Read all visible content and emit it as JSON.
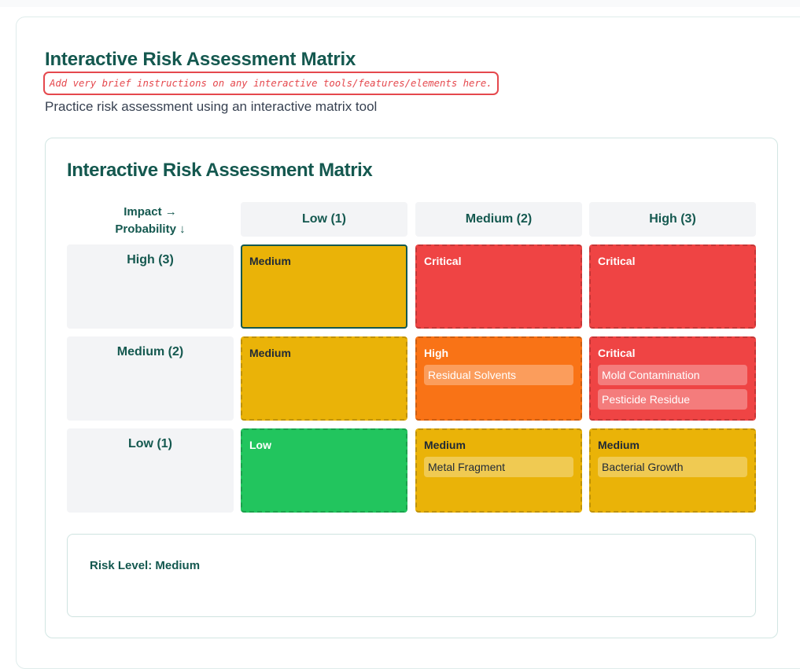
{
  "page": {
    "title": "Interactive Risk Assessment Matrix",
    "instruction": "Add very brief instructions on any interactive tools/features/elements here.",
    "subtitle": "Practice risk assessment using an interactive matrix tool"
  },
  "matrix": {
    "title": "Interactive Risk Assessment Matrix",
    "axis_impact": "Impact →",
    "axis_probability": "Probability ↓",
    "columns": [
      "Low (1)",
      "Medium (2)",
      "High (3)"
    ],
    "rows": [
      {
        "label": "High (3)",
        "cells": [
          {
            "level": "Medium",
            "color": "#eab308",
            "text_color": "#1f2937",
            "selected": true,
            "items": []
          },
          {
            "level": "Critical",
            "color": "#ef4444",
            "text_color": "#ffffff",
            "items": []
          },
          {
            "level": "Critical",
            "color": "#ef4444",
            "text_color": "#ffffff",
            "items": []
          }
        ]
      },
      {
        "label": "Medium (2)",
        "cells": [
          {
            "level": "Medium",
            "color": "#eab308",
            "text_color": "#1f2937",
            "items": []
          },
          {
            "level": "High",
            "color": "#f97316",
            "text_color": "#ffffff",
            "items": [
              "Residual Solvents"
            ]
          },
          {
            "level": "Critical",
            "color": "#ef4444",
            "text_color": "#ffffff",
            "items": [
              "Mold Contamination",
              "Pesticide Residue"
            ]
          }
        ]
      },
      {
        "label": "Low (1)",
        "cells": [
          {
            "level": "Low",
            "color": "#22c55e",
            "text_color": "#ffffff",
            "items": []
          },
          {
            "level": "Medium",
            "color": "#eab308",
            "text_color": "#1f2937",
            "items": [
              "Metal Fragment"
            ]
          },
          {
            "level": "Medium",
            "color": "#eab308",
            "text_color": "#1f2937",
            "items": [
              "Bacterial Growth"
            ]
          }
        ]
      }
    ]
  },
  "summary": {
    "text": "Risk Level: Medium"
  }
}
